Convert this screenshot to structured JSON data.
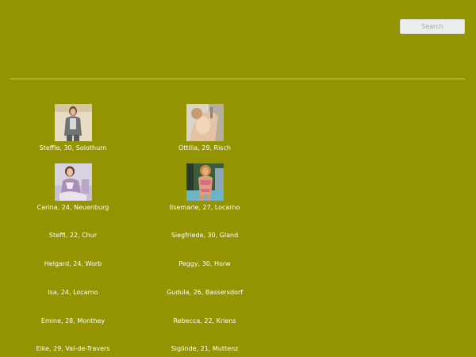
{
  "search": {
    "placeholder": "Search",
    "value": ""
  },
  "colors": {
    "background": "#949400",
    "divider": "#c9c98a",
    "text": "#ffffff"
  },
  "profiles": [
    {
      "caption": "Steffie, 30, Solothurn",
      "photo": "photo-thumbnail"
    },
    {
      "caption": "Ottilia, 29, Risch",
      "photo": "photo-thumbnail"
    },
    {
      "caption": "Carina, 24, Neuenburg",
      "photo": "photo-thumbnail"
    },
    {
      "caption": "Ilsemarie, 27, Locarno",
      "photo": "photo-thumbnail"
    },
    {
      "caption": "Steffi, 22, Chur"
    },
    {
      "caption": "Siegfriede, 30, Gland"
    },
    {
      "caption": "Helgard, 24, Worb"
    },
    {
      "caption": "Peggy, 30, Horw"
    },
    {
      "caption": "Isa, 24, Locarno"
    },
    {
      "caption": "Gudula, 26, Bassersdorf"
    },
    {
      "caption": "Emine, 28, Monthey"
    },
    {
      "caption": "Rebecca, 22, Kriens"
    },
    {
      "caption": "Eike, 29, Val-de-Travers"
    },
    {
      "caption": "Siglinde, 21, Muttenz"
    }
  ]
}
